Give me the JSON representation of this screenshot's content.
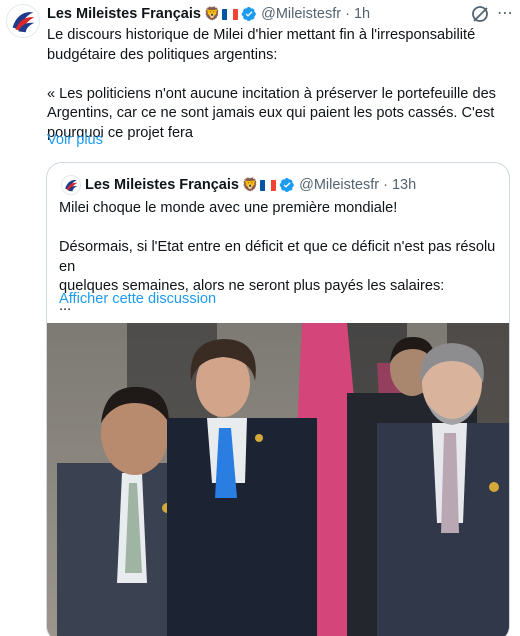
{
  "tweet": {
    "author_name": "Les Mileistes Français",
    "author_emoji": "🦁",
    "handle": "@Mileistesfr",
    "separator": "·",
    "time": "1h",
    "text_line1": "Le discours historique de Milei d'hier mettant fin à l'irresponsabilité",
    "text_line2": "budgétaire des politiques argentins:",
    "text_line3": "« Les politiciens n'ont aucune incitation à préserver le portefeuille des",
    "text_line4": "Argentins, car ce ne sont jamais eux qui paient les pots cassés. C'est",
    "text_line5": "pourquoi ce projet fera",
    "show_more": "Voir plus"
  },
  "quote": {
    "author_name": "Les Mileistes Français",
    "author_emoji": "🦁",
    "handle": "@Mileistesfr",
    "separator": "·",
    "time": "13h",
    "text_line1": "Milei choque le monde avec une première mondiale!",
    "text_line2": "Désormais, si l'Etat entre en déficit et que ce déficit n'est pas résolu en",
    "text_line3": "quelques semaines, alors ne seront plus payés les salaires:",
    "text_line4": "...",
    "show_thread": "Afficher cette discussion"
  },
  "colors": {
    "link": "#1d9bf0",
    "muted": "#536471",
    "verified": "#1d9bf0",
    "flag_blue": "#0055a4",
    "flag_red": "#ef4135",
    "carpet": "#d4457a"
  },
  "icons": {
    "verified": "verified-badge-icon",
    "grok": "grok-icon",
    "more": "more-options-icon"
  }
}
